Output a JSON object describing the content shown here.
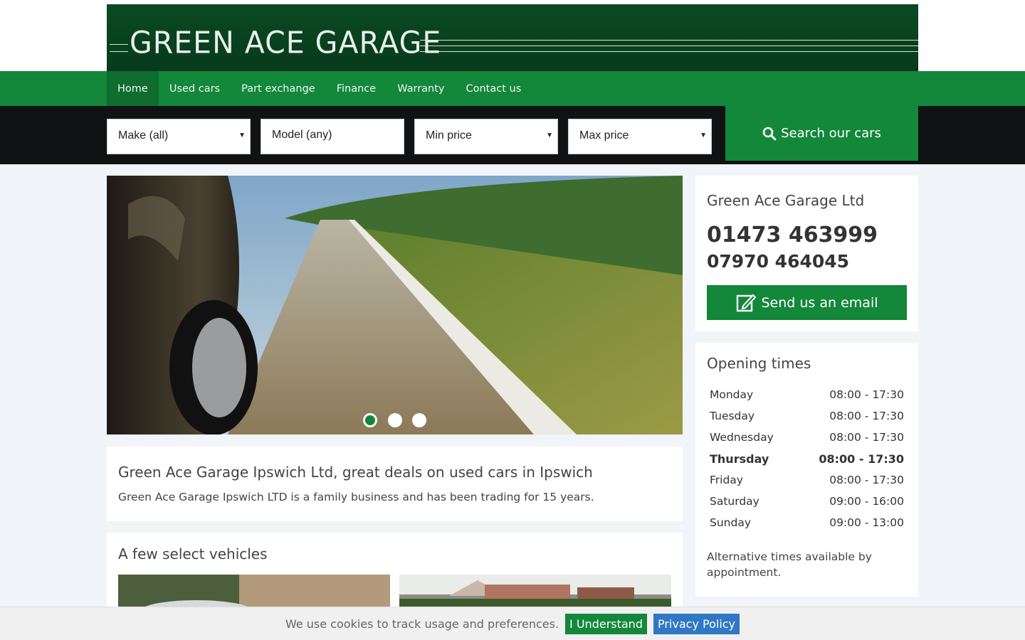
{
  "brand": {
    "logo_text": "GREEN ACE GARAGE"
  },
  "nav": {
    "items": [
      {
        "label": "Home"
      },
      {
        "label": "Used cars"
      },
      {
        "label": "Part exchange"
      },
      {
        "label": "Finance"
      },
      {
        "label": "Warranty"
      },
      {
        "label": "Contact us"
      }
    ]
  },
  "search": {
    "make": "Make (all)",
    "model": "Model (any)",
    "min_price": "Min price",
    "max_price": "Max price",
    "button": "Search our cars"
  },
  "hero": {
    "slide_count": 3,
    "active_slide": 1
  },
  "intro": {
    "title": "Green Ace Garage Ipswich Ltd, great deals on used cars in Ipswich",
    "text": "Green Ace Garage Ipswich LTD is a family business and has been trading for 15 years."
  },
  "vehicles": {
    "title": "A few select vehicles"
  },
  "contact": {
    "company": "Green Ace Garage Ltd",
    "phone1": "01473 463999",
    "phone2": "07970 464045",
    "email_button": "Send us an email"
  },
  "opening": {
    "title": "Opening times",
    "rows": [
      {
        "day": "Monday",
        "hours": "08:00 - 17:30"
      },
      {
        "day": "Tuesday",
        "hours": "08:00 - 17:30"
      },
      {
        "day": "Wednesday",
        "hours": "08:00 - 17:30"
      },
      {
        "day": "Thursday",
        "hours": "08:00 - 17:30"
      },
      {
        "day": "Friday",
        "hours": "08:00 - 17:30"
      },
      {
        "day": "Saturday",
        "hours": "09:00 - 16:00"
      },
      {
        "day": "Sunday",
        "hours": "09:00 - 13:00"
      }
    ],
    "note": "Alternative times available by appointment."
  },
  "cookie": {
    "text": "We use cookies to track usage and preferences.",
    "accept": "I Understand",
    "privacy": "Privacy Policy"
  },
  "colors": {
    "brand_green": "#13873a",
    "dark_green": "#0a4a23",
    "search_band": "#111213",
    "privacy_blue": "#2f78c4"
  }
}
